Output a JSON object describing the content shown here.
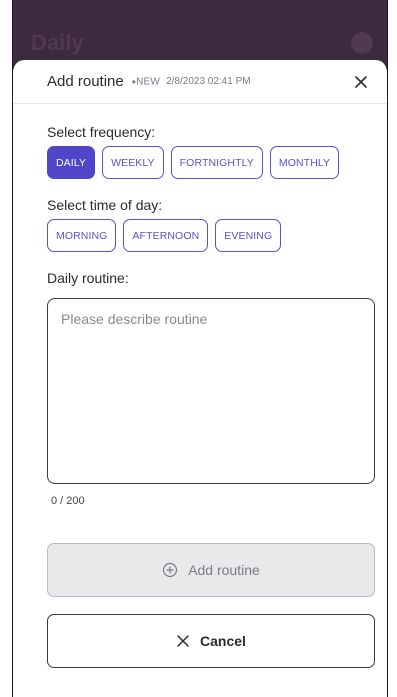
{
  "background": {
    "title": "Daily"
  },
  "sheet": {
    "title": "Add routine",
    "new_tag": "NEW",
    "timestamp": "2/8/2023 02:41 PM"
  },
  "frequency": {
    "label": "Select frequency:",
    "options": [
      "DAILY",
      "WEEKLY",
      "FORTNIGHTLY",
      "MONTHLY"
    ],
    "selected": "DAILY"
  },
  "time_of_day": {
    "label": "Select time of day:",
    "options": [
      "MORNING",
      "AFTERNOON",
      "EVENING"
    ]
  },
  "routine": {
    "label": "Daily routine:",
    "placeholder": "Please describe routine",
    "value": "",
    "char_count": "0 / 200"
  },
  "buttons": {
    "add_label": "Add routine",
    "cancel_label": "Cancel"
  },
  "colors": {
    "accent": "#4f46c8",
    "backdrop": "#3d2a40"
  },
  "icons": {
    "close": "close-icon",
    "add": "plus-circle-icon",
    "cancel": "x-icon"
  }
}
